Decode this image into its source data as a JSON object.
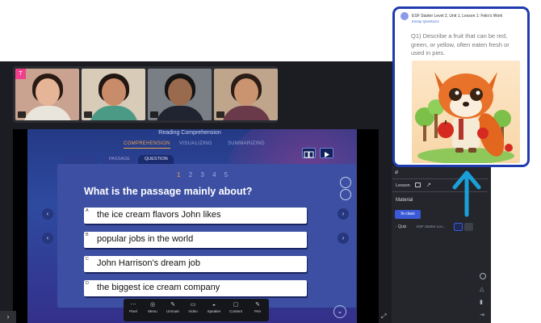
{
  "app": {
    "slide_title": "Reading Comprehension",
    "tabs": [
      "COMPREHENSION",
      "VISUALIZING",
      "SUMMARIZING"
    ],
    "subtabs": [
      "PASSAGE",
      "QUESTION"
    ],
    "pager": {
      "current": "1",
      "others": [
        "2",
        "3",
        "4",
        "5"
      ]
    },
    "question": "What is the passage mainly about?",
    "options": [
      {
        "letter": "A",
        "text": "the ice cream flavors John likes"
      },
      {
        "letter": "B",
        "text": "popular jobs in the world"
      },
      {
        "letter": "C",
        "text": "John Harrison's dream job"
      },
      {
        "letter": "D",
        "text": "the biggest ice cream company"
      }
    ],
    "toolbar": [
      {
        "icon": "pixel-icon",
        "label": "Pixel",
        "glyph": "⋯"
      },
      {
        "icon": "menu-icon",
        "label": "Menu",
        "glyph": "◎"
      },
      {
        "icon": "unmute-icon",
        "label": "Unmute",
        "glyph": "✎"
      },
      {
        "icon": "video-icon",
        "label": "Video",
        "glyph": "▭"
      },
      {
        "icon": "speaker-icon",
        "label": "Speaker",
        "glyph": "◒"
      },
      {
        "icon": "content-icon",
        "label": "Content",
        "glyph": "▢"
      },
      {
        "icon": "pen-icon",
        "label": "Pen",
        "glyph": "✎"
      }
    ],
    "participant_initial": "T"
  },
  "sidebar": {
    "lesson_label": "Lesson",
    "material_label": "Material",
    "inclass_badge": "In-class",
    "quiz_label": "· Quiz",
    "quiz_title": "ESF Starter Lev..."
  },
  "card": {
    "title": "ESF Starter Level 2, Unit 1, Lesson 1: Felix's Work",
    "subtitle": "Essay Questions",
    "question": "Q1) Describe a fruit that can be red, green, or yellow, often eaten fresh or used in pies."
  },
  "colors": {
    "accent": "#f0a24a",
    "card_border": "#1f3bb0",
    "arrow": "#1aa0d8",
    "inclass": "#3a5ad8"
  }
}
